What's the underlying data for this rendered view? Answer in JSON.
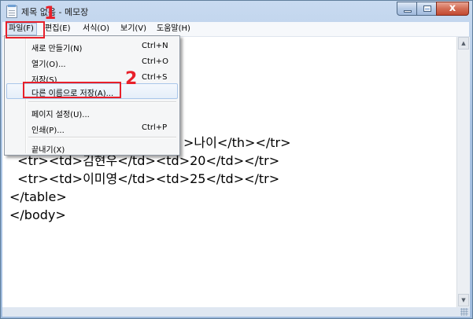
{
  "window": {
    "title": "제목 없음 - 메모장",
    "close_glyph": "x"
  },
  "menubar": {
    "items": [
      {
        "label": "파일(F)"
      },
      {
        "label": "편집(E)"
      },
      {
        "label": "서식(O)"
      },
      {
        "label": "보기(V)"
      },
      {
        "label": "도움말(H)"
      }
    ]
  },
  "file_menu": {
    "items": [
      {
        "label": "새로 만들기(N)",
        "shortcut": "Ctrl+N"
      },
      {
        "label": "열기(O)...",
        "shortcut": "Ctrl+O"
      },
      {
        "label": "저장(S)",
        "shortcut": "Ctrl+S"
      },
      {
        "label": "다른 이름으로 저장(A)...",
        "shortcut": ""
      },
      {
        "label": "페이지 설정(U)...",
        "shortcut": ""
      },
      {
        "label": "인쇄(P)...",
        "shortcut": "Ctrl+P"
      },
      {
        "label": "끝내기(X)",
        "shortcut": ""
      }
    ]
  },
  "editor": {
    "lines": [
      ">나이</th></tr>",
      "  <tr><td>김현우</td><td>20</td></tr>",
      "  <tr><td>이미영</td><td>25</td></tr>",
      "</table>",
      "</body>"
    ]
  },
  "annotations": {
    "step1": "1",
    "step2": "2",
    "color": "#e8202a"
  },
  "scrollbar": {
    "up_glyph": "▲",
    "down_glyph": "▼"
  }
}
